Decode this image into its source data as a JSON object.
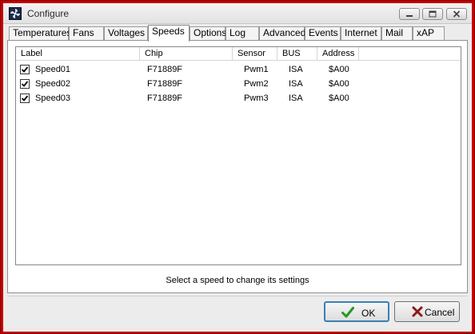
{
  "window": {
    "title": "Configure"
  },
  "tabs": [
    {
      "label": "Temperatures",
      "name": "tab-temperatures"
    },
    {
      "label": "Fans",
      "name": "tab-fans"
    },
    {
      "label": "Voltages",
      "name": "tab-voltages"
    },
    {
      "label": "Speeds",
      "name": "tab-speeds",
      "active": true
    },
    {
      "label": "Options",
      "name": "tab-options"
    },
    {
      "label": "Log",
      "name": "tab-log"
    },
    {
      "label": "Advanced",
      "name": "tab-advanced"
    },
    {
      "label": "Events",
      "name": "tab-events"
    },
    {
      "label": "Internet",
      "name": "tab-internet"
    },
    {
      "label": "Mail",
      "name": "tab-mail"
    },
    {
      "label": "xAP",
      "name": "tab-xap"
    }
  ],
  "list": {
    "columns": [
      "Label",
      "Chip",
      "Sensor",
      "BUS",
      "Address"
    ],
    "rows": [
      {
        "checked": true,
        "label": "Speed01",
        "chip": "F71889F",
        "sensor": "Pwm1",
        "bus": "ISA",
        "address": "$A00"
      },
      {
        "checked": true,
        "label": "Speed02",
        "chip": "F71889F",
        "sensor": "Pwm2",
        "bus": "ISA",
        "address": "$A00"
      },
      {
        "checked": true,
        "label": "Speed03",
        "chip": "F71889F",
        "sensor": "Pwm3",
        "bus": "ISA",
        "address": "$A00"
      }
    ]
  },
  "hint": "Select a speed to change its settings",
  "buttons": {
    "ok_label": "OK",
    "cancel_label": "Cancel"
  },
  "colors": {
    "window_frame": "#c40000",
    "ok_check": "#1e9b1e",
    "cancel_x": "#8b1a1a",
    "default_button_border": "#3c7fb1"
  }
}
